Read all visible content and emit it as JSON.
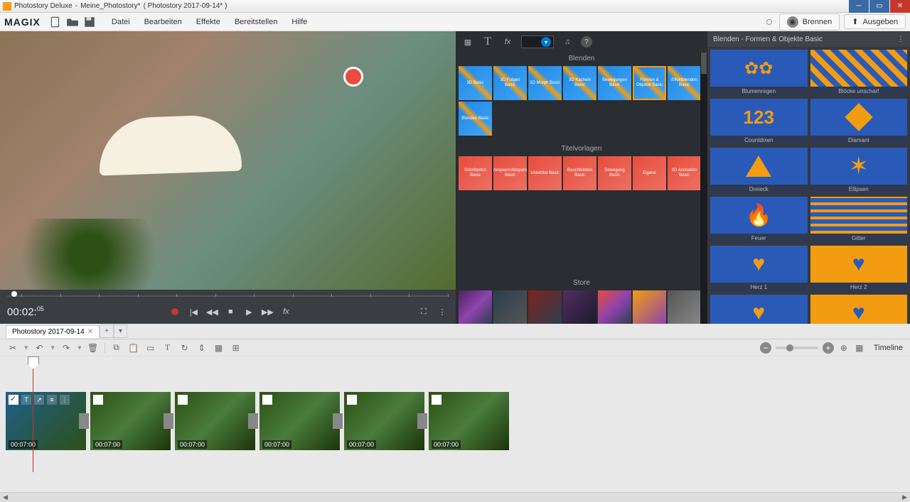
{
  "titlebar": {
    "app_name": "Photostory Deluxe",
    "project_name": "Meine_Photostory*",
    "document": "( Photostory 2017-09-14* )"
  },
  "menu": {
    "brand": "MAGIX",
    "items": [
      "Datei",
      "Bearbeiten",
      "Effekte",
      "Bereitstellen",
      "Hilfe"
    ],
    "burn": "Brennen",
    "export": "Ausgeben"
  },
  "preview": {
    "time": "00:02",
    "time_frames": "05"
  },
  "fx_panel": {
    "section_blenden": "Blenden",
    "section_titel": "Titelvorlagen",
    "section_store": "Store",
    "blenden_items": [
      "3D Basic",
      "3D Folgen Basic",
      "3D Morph Basic",
      "3D Kacheln Basic",
      "Bewegungen Basic",
      "Formen & Objekte Basic",
      "Effektblenden Basic",
      "Blenden Basic"
    ],
    "titel_items": [
      "Schriftarten Basic",
      "Vorspann/Abspann Basic",
      "Untertitel Basic",
      "Bauchbinden Basic",
      "Bewegung Basic",
      "Eigene",
      "3D Animation Basic"
    ]
  },
  "side_panel": {
    "title": "Blenden - Formen & Objekte Basic",
    "items": [
      {
        "label": "Blumenregen",
        "shape": "gear"
      },
      {
        "label": "Blöcke unscharf",
        "shape": "blocks"
      },
      {
        "label": "Countdown",
        "shape": "123"
      },
      {
        "label": "Diamant",
        "shape": "diamond"
      },
      {
        "label": "Dreieck",
        "shape": "tri"
      },
      {
        "label": "Ellipsen",
        "shape": "star"
      },
      {
        "label": "Feuer",
        "shape": "fire"
      },
      {
        "label": "Gitter",
        "shape": "grid"
      },
      {
        "label": "Herz 1",
        "shape": "heart"
      },
      {
        "label": "Herz 2",
        "shape": "heart2"
      },
      {
        "label": "",
        "shape": "heart"
      },
      {
        "label": "",
        "shape": "heart2b"
      }
    ]
  },
  "timeline": {
    "tab_name": "Photostory 2017-09-14",
    "mode_label": "Timeline",
    "clip_duration": "00:07:00"
  }
}
